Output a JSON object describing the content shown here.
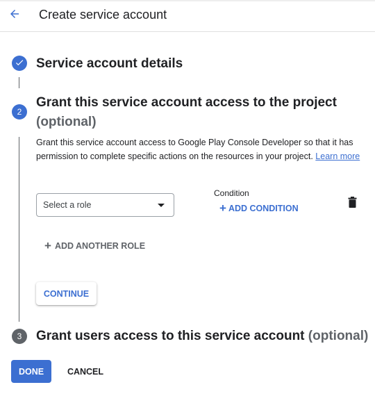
{
  "header": {
    "title": "Create service account",
    "back_icon": "arrow-back-icon"
  },
  "colors": {
    "accent": "#3c6fd1",
    "muted": "#5f6368",
    "text": "#202124"
  },
  "steps": [
    {
      "index": "1",
      "title": "Service account details",
      "state": "completed",
      "icon": "check-icon"
    },
    {
      "index": "2",
      "title": "Grant this service account access to the project",
      "optional_label": "(optional)",
      "state": "active"
    },
    {
      "index": "3",
      "title": "Grant users access to this service account",
      "optional_label": "(optional)",
      "state": "pending"
    }
  ],
  "grant_section": {
    "description": "Grant this service account access to Google Play Console Developer so that it has permission to complete specific actions on the resources in your project.",
    "learn_more": "Learn more",
    "role_select": {
      "placeholder": "Select a role",
      "value": ""
    },
    "condition_label": "Condition",
    "add_condition_label": "ADD CONDITION",
    "delete_icon": "trash-icon",
    "add_another_role_label": "ADD ANOTHER ROLE",
    "continue_label": "CONTINUE"
  },
  "footer": {
    "done_label": "DONE",
    "cancel_label": "CANCEL"
  }
}
